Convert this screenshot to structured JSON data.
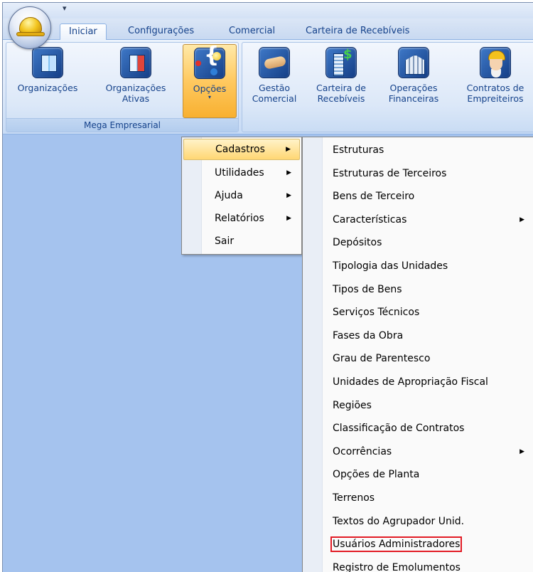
{
  "ribbon": {
    "tabs": [
      "Iniciar",
      "Configurações",
      "Comercial",
      "Carteira de Recebíveis"
    ],
    "group1": {
      "label": "Mega Empresarial",
      "buttons": [
        {
          "line1": "Organizações",
          "line2": ""
        },
        {
          "line1": "Organizações",
          "line2": "Ativas"
        },
        {
          "line1": "Opções",
          "line2": "▾"
        }
      ]
    },
    "group2": {
      "buttons": [
        {
          "line1": "Gestão",
          "line2": "Comercial"
        },
        {
          "line1": "Carteira de",
          "line2": "Recebíveis"
        },
        {
          "line1": "Operações",
          "line2": "Financeiras"
        },
        {
          "line1": "Contratos de",
          "line2": "Empreiteiros"
        }
      ]
    }
  },
  "options_menu": {
    "items": [
      "Cadastros",
      "Utilidades",
      "Ajuda",
      "Relatórios",
      "Sair"
    ]
  },
  "cadastros_menu": {
    "items": [
      "Estruturas",
      "Estruturas de Terceiros",
      "Bens de Terceiro",
      "Características",
      "Depósitos",
      "Tipologia das Unidades",
      "Tipos de Bens",
      "Serviços Técnicos",
      "Fases da Obra",
      "Grau de Parentesco",
      "Unidades de Apropriação Fiscal",
      "Regiões",
      "Classificação de Contratos",
      "Ocorrências",
      "Opções de Planta",
      "Terrenos",
      "Textos do Agrupador Unid.",
      "Usuários Administradores",
      "Registro de Emolumentos"
    ]
  },
  "icons": {
    "orb": "hard-hat-icon",
    "qat": "customize-toolbar-arrow-icon"
  }
}
